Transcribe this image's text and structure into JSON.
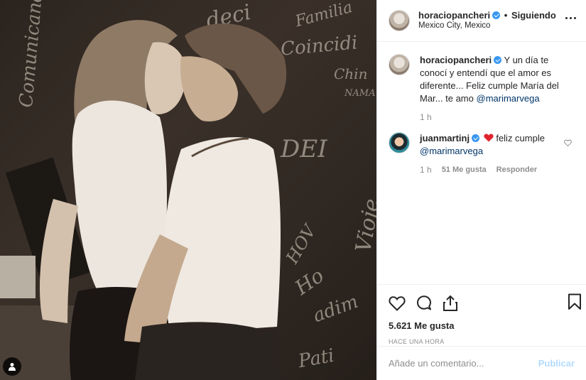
{
  "photo": {
    "chalk_words": [
      "Comunicando",
      "deci",
      "Familia",
      "Coincidi",
      "Chin",
      "NAMA",
      "DEI",
      "Ho",
      "Vioje",
      "adim",
      "Pati",
      "HOV"
    ]
  },
  "post": {
    "username": "horaciopancheri",
    "separator": "•",
    "follow_status": "Siguiendo",
    "location": "Mexico City, Mexico",
    "caption_text": "Y un día te conocí y entendí que el amor es diferente... Feliz cumple María del Mar... te amo",
    "caption_mention": "@marimarvega",
    "caption_time": "1 h"
  },
  "comments": [
    {
      "username": "juanmartinj",
      "text": "feliz cumple",
      "mention": "@marimarvega",
      "time": "1 h",
      "likes": "51 Me gusta",
      "reply_label": "Responder"
    }
  ],
  "stats": {
    "likes": "5.621 Me gusta",
    "posted": "HACE UNA HORA"
  },
  "composer": {
    "placeholder": "Añade un comentario...",
    "publish_label": "Publicar"
  },
  "colors": {
    "verified": "#3897f0",
    "link": "#003569",
    "publish_disabled": "#b3dbff",
    "heart_red": "#ed4956"
  },
  "icons": [
    "more-options-icon",
    "verified-icon",
    "heart-icon",
    "comment-icon",
    "share-icon",
    "bookmark-icon",
    "user-tag-icon",
    "red-heart-emoji"
  ]
}
